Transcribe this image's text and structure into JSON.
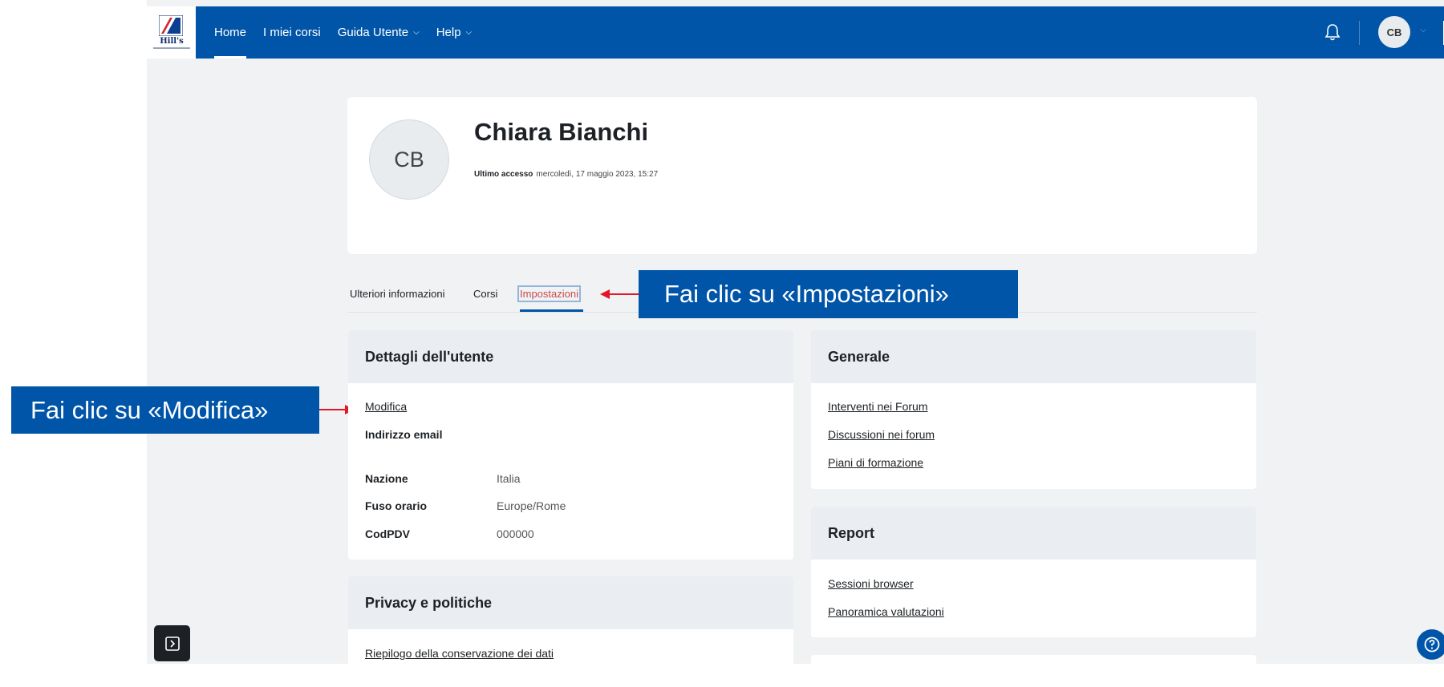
{
  "navbar": {
    "logo_text": "Hill's",
    "links": [
      {
        "label": "Home",
        "active": true
      },
      {
        "label": "I miei corsi"
      },
      {
        "label": "Guida Utente"
      },
      {
        "label": "Help"
      }
    ],
    "user_initials": "CB",
    "color": "#0055a8"
  },
  "profile": {
    "initials": "CB",
    "name": "Chiara Bianchi",
    "last_access_label": "Ultimo accesso",
    "last_access_value": "mercoledì, 17 maggio 2023, 15:27"
  },
  "tabs": [
    {
      "label": "Ulteriori informazioni"
    },
    {
      "label": "Corsi"
    },
    {
      "label": "Impostazioni",
      "active": true
    }
  ],
  "callouts": {
    "impostazioni": "Fai clic su «Impostazioni»",
    "modifica": "Fai clic su «Modifica»",
    "arrow_color": "#e4162a"
  },
  "user_details": {
    "title": "Dettagli dell'utente",
    "edit_link": "Modifica",
    "email_label": "Indirizzo email",
    "fields": [
      {
        "label": "Nazione",
        "value": "Italia"
      },
      {
        "label": "Fuso orario",
        "value": "Europe/Rome"
      },
      {
        "label": "CodPDV",
        "value": "000000"
      }
    ]
  },
  "privacy": {
    "title": "Privacy e politiche",
    "links": [
      "Riepilogo della conservazione dei dati"
    ]
  },
  "general": {
    "title": "Generale",
    "links": [
      "Interventi nei Forum",
      "Discussioni nei forum",
      "Piani di formazione"
    ]
  },
  "report": {
    "title": "Report",
    "links": [
      "Sessioni browser",
      "Panoramica valutazioni"
    ]
  },
  "icons": {
    "bell": "bell-icon",
    "drawer": "drawer-toggle-icon",
    "help": "help-icon"
  }
}
